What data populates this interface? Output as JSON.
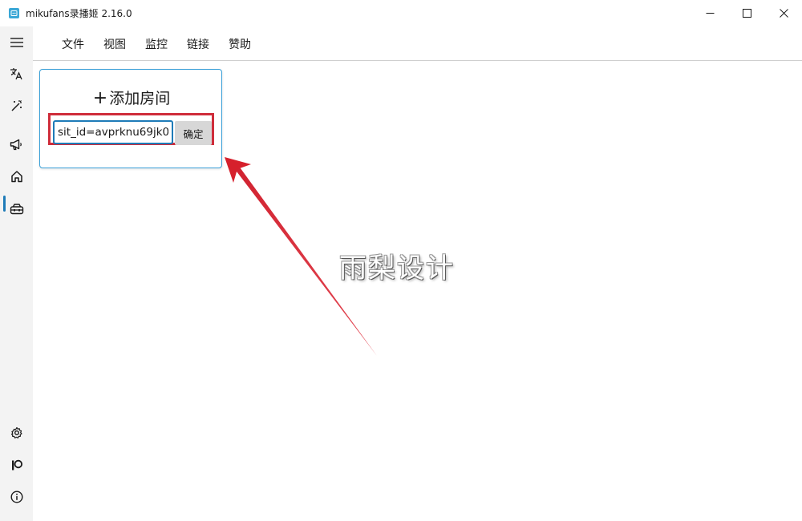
{
  "window": {
    "title": "mikufans录播姬 2.16.0",
    "buttons": [
      "minimize-icon",
      "maximize-icon",
      "close-icon"
    ]
  },
  "rail": {
    "items": [
      {
        "icon": "hamburger-menu-icon"
      },
      {
        "icon": "translate-icon"
      },
      {
        "icon": "magic-wand-icon"
      },
      {
        "icon": "megaphone-icon"
      },
      {
        "icon": "home-icon",
        "active": true
      },
      {
        "icon": "toolbox-icon"
      },
      {
        "icon": "gear-icon"
      },
      {
        "icon": "parking-sign-icon"
      },
      {
        "icon": "info-icon"
      }
    ],
    "accent_color": "#1e7bb8"
  },
  "menu": {
    "items": [
      "文件",
      "视图",
      "监控",
      "链接",
      "赞助"
    ]
  },
  "add_room": {
    "title": "添加房间",
    "input_value": "sit_id=avprknu69jk0",
    "confirm_label": "确定",
    "highlight_color": "#cf2c3a",
    "card_border_color": "#3aa0d8"
  },
  "watermark": "雨梨设计"
}
